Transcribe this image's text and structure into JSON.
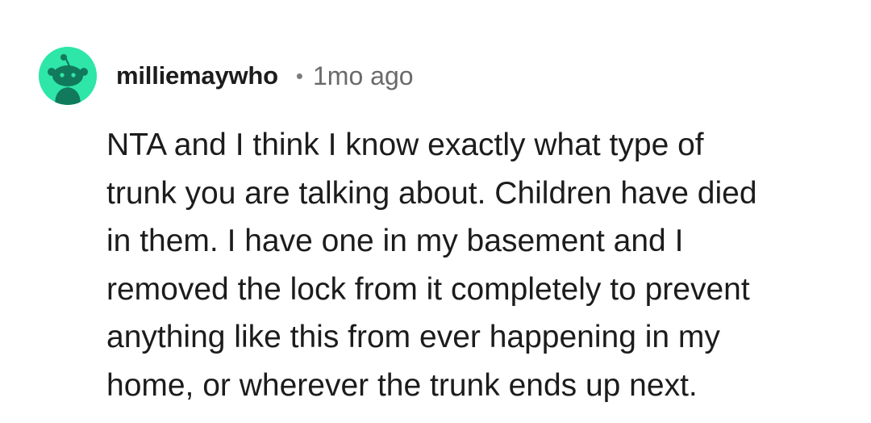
{
  "comment": {
    "avatar_icon": "reddit-snoo-avatar-icon",
    "avatar_color": "#2ee6a8",
    "username": "milliemaywho",
    "separator": "•",
    "timestamp": "1mo ago",
    "body_lines": [
      "NTA and I think I know exactly what type of",
      "trunk you are talking about. Children have died",
      "in them. I have one in my basement and I",
      "removed the lock from it completely to prevent",
      "anything like this from ever happening in my",
      "home, or wherever the trunk ends up next."
    ]
  }
}
